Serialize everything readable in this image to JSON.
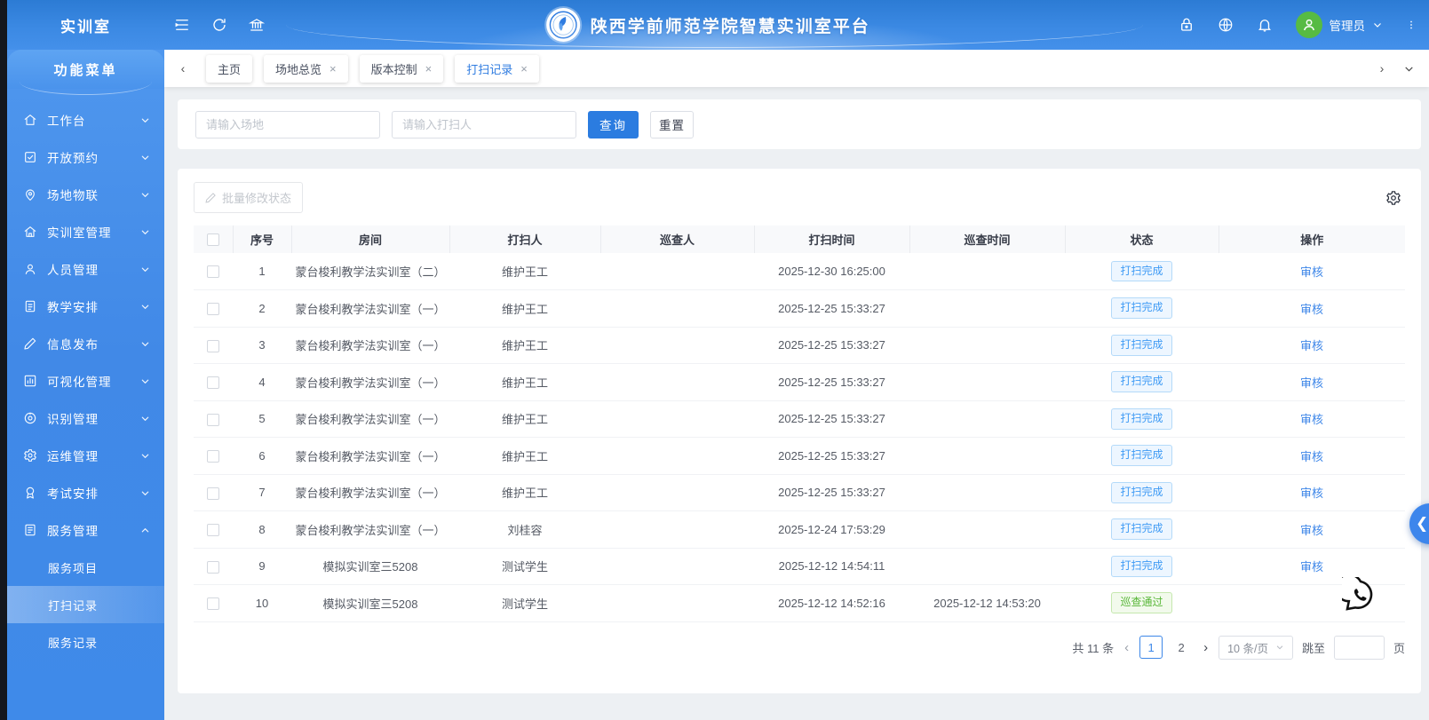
{
  "app": {
    "brand": "实训室",
    "menu_header": "功能菜单",
    "platform_title": "陕西学前师范学院智慧实训室平台"
  },
  "topbar": {
    "user": "管理员",
    "left_icons": [
      "menu-fold-icon",
      "refresh-icon",
      "institution-icon"
    ],
    "right_icons": [
      "lock-icon",
      "globe-icon",
      "bell-icon"
    ],
    "avatar_icon": "user-icon",
    "more_icon": "more-vertical-icon"
  },
  "tabs": {
    "items": [
      {
        "label": "主页",
        "closable": false,
        "active": false
      },
      {
        "label": "场地总览",
        "closable": true,
        "active": false
      },
      {
        "label": "版本控制",
        "closable": true,
        "active": false
      },
      {
        "label": "打扫记录",
        "closable": true,
        "active": true
      }
    ]
  },
  "sidebar": {
    "items": [
      {
        "label": "工作台",
        "icon": "home-icon",
        "expanded": false
      },
      {
        "label": "开放预约",
        "icon": "check-square-icon",
        "expanded": false
      },
      {
        "label": "场地物联",
        "icon": "map-pin-icon",
        "expanded": false
      },
      {
        "label": "实训室管理",
        "icon": "building-icon",
        "expanded": false
      },
      {
        "label": "人员管理",
        "icon": "user-icon",
        "expanded": false
      },
      {
        "label": "教学安排",
        "icon": "file-text-icon",
        "expanded": false
      },
      {
        "label": "信息发布",
        "icon": "edit-icon",
        "expanded": false
      },
      {
        "label": "可视化管理",
        "icon": "chart-icon",
        "expanded": false
      },
      {
        "label": "识别管理",
        "icon": "face-icon",
        "expanded": false
      },
      {
        "label": "运维管理",
        "icon": "gear-icon",
        "expanded": false
      },
      {
        "label": "考试安排",
        "icon": "award-icon",
        "expanded": false
      },
      {
        "label": "服务管理",
        "icon": "book-icon",
        "expanded": true,
        "children": [
          {
            "label": "服务项目",
            "active": false
          },
          {
            "label": "打扫记录",
            "active": true
          },
          {
            "label": "服务记录",
            "active": false
          }
        ]
      }
    ]
  },
  "search": {
    "venue_placeholder": "请输入场地",
    "cleaner_placeholder": "请输入打扫人",
    "query_label": "查询",
    "reset_label": "重置"
  },
  "toolbar": {
    "batch_edit_label": "批量修改状态"
  },
  "table": {
    "headers": [
      "序号",
      "房间",
      "打扫人",
      "巡查人",
      "打扫时间",
      "巡查时间",
      "状态",
      "操作"
    ],
    "rows": [
      {
        "no": "1",
        "room": "蒙台梭利教学法实训室（二）",
        "cleaner": "维护王工",
        "inspector": "",
        "clean_time": "2025-12-30 16:25:00",
        "inspect_time": "",
        "status": "打扫完成",
        "status_type": "blue",
        "action": "审核"
      },
      {
        "no": "2",
        "room": "蒙台梭利教学法实训室（一）",
        "cleaner": "维护王工",
        "inspector": "",
        "clean_time": "2025-12-25 15:33:27",
        "inspect_time": "",
        "status": "打扫完成",
        "status_type": "blue",
        "action": "审核"
      },
      {
        "no": "3",
        "room": "蒙台梭利教学法实训室（一）",
        "cleaner": "维护王工",
        "inspector": "",
        "clean_time": "2025-12-25 15:33:27",
        "inspect_time": "",
        "status": "打扫完成",
        "status_type": "blue",
        "action": "审核"
      },
      {
        "no": "4",
        "room": "蒙台梭利教学法实训室（一）",
        "cleaner": "维护王工",
        "inspector": "",
        "clean_time": "2025-12-25 15:33:27",
        "inspect_time": "",
        "status": "打扫完成",
        "status_type": "blue",
        "action": "审核"
      },
      {
        "no": "5",
        "room": "蒙台梭利教学法实训室（一）",
        "cleaner": "维护王工",
        "inspector": "",
        "clean_time": "2025-12-25 15:33:27",
        "inspect_time": "",
        "status": "打扫完成",
        "status_type": "blue",
        "action": "审核"
      },
      {
        "no": "6",
        "room": "蒙台梭利教学法实训室（一）",
        "cleaner": "维护王工",
        "inspector": "",
        "clean_time": "2025-12-25 15:33:27",
        "inspect_time": "",
        "status": "打扫完成",
        "status_type": "blue",
        "action": "审核"
      },
      {
        "no": "7",
        "room": "蒙台梭利教学法实训室（一）",
        "cleaner": "维护王工",
        "inspector": "",
        "clean_time": "2025-12-25 15:33:27",
        "inspect_time": "",
        "status": "打扫完成",
        "status_type": "blue",
        "action": "审核"
      },
      {
        "no": "8",
        "room": "蒙台梭利教学法实训室（一）",
        "cleaner": "刘桂容",
        "inspector": "",
        "clean_time": "2025-12-24 17:53:29",
        "inspect_time": "",
        "status": "打扫完成",
        "status_type": "blue",
        "action": "审核"
      },
      {
        "no": "9",
        "room": "模拟实训室三5208",
        "cleaner": "测试学生",
        "inspector": "",
        "clean_time": "2025-12-12 14:54:11",
        "inspect_time": "",
        "status": "打扫完成",
        "status_type": "blue",
        "action": "审核"
      },
      {
        "no": "10",
        "room": "模拟实训室三5208",
        "cleaner": "测试学生",
        "inspector": "",
        "clean_time": "2025-12-12 14:52:16",
        "inspect_time": "2025-12-12 14:53:20",
        "status": "巡查通过",
        "status_type": "green",
        "action": ""
      }
    ]
  },
  "pagination": {
    "total": "共 11 条",
    "pages": [
      {
        "label": "1",
        "active": true
      },
      {
        "label": "2",
        "active": false
      }
    ],
    "size": "10 条/页",
    "jump_label": "跳至",
    "jump_unit": "页"
  },
  "colors": {
    "accent": "#2b7ce0",
    "status_blue": "#3f9bf5",
    "status_green": "#58b738",
    "avatar_green": "#57bb43",
    "sidebar_blue": "#4189e7"
  }
}
